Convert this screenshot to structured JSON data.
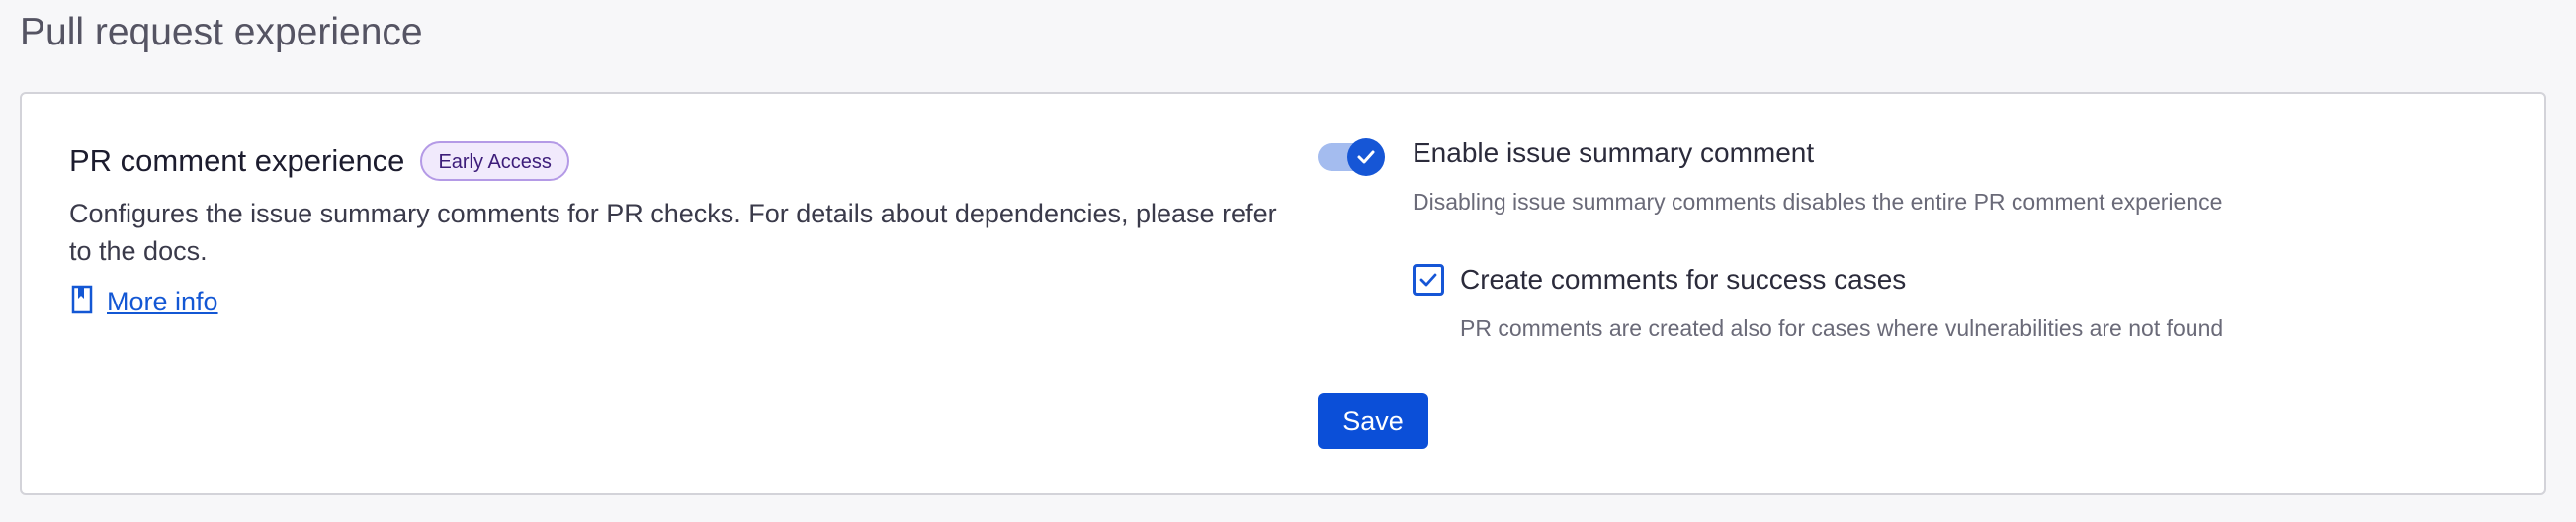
{
  "page": {
    "title": "Pull request experience"
  },
  "section": {
    "heading": "PR comment experience",
    "badge": "Early Access",
    "description": "Configures the issue summary comments for PR checks. For details about dependencies, please refer to the docs.",
    "more_info_label": "More info",
    "more_info_icon": "book-icon"
  },
  "settings": {
    "enable_summary": {
      "label": "Enable issue summary comment",
      "help": "Disabling issue summary comments disables the entire PR comment experience",
      "enabled": true
    },
    "success_cases": {
      "label": "Create comments for success cases",
      "help": "PR comments are created also for cases where vulnerabilities are not found",
      "checked": true
    }
  },
  "actions": {
    "save_label": "Save"
  },
  "colors": {
    "accent": "#1656d6",
    "badge_bg": "#f1eafc",
    "badge_border": "#b49ae6",
    "link": "#1357d4"
  }
}
